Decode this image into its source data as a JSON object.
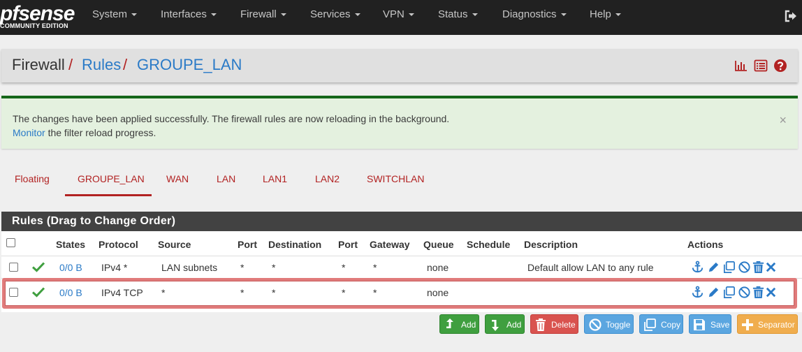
{
  "brand": {
    "name": "pfsense",
    "edition": "COMMUNITY EDITION"
  },
  "nav": {
    "items": [
      "System",
      "Interfaces",
      "Firewall",
      "Services",
      "VPN",
      "Status",
      "Diagnostics",
      "Help"
    ]
  },
  "breadcrumb": {
    "root": "Firewall",
    "sep": "/",
    "rules": "Rules",
    "current": "GROUPE_LAN"
  },
  "alert": {
    "line1": "The changes have been applied successfully. The firewall rules are now reloading in the background.",
    "link": "Monitor",
    "line2_rest": " the filter reload progress.",
    "close": "×"
  },
  "tabs": [
    "Floating",
    "GROUPE_LAN",
    "WAN",
    "LAN",
    "LAN1",
    "LAN2",
    "SWITCHLAN"
  ],
  "active_tab": "GROUPE_LAN",
  "rules_panel": {
    "title": "Rules (Drag to Change Order)",
    "columns": [
      "States",
      "Protocol",
      "Source",
      "Port",
      "Destination",
      "Port",
      "Gateway",
      "Queue",
      "Schedule",
      "Description",
      "Actions"
    ],
    "rows": [
      {
        "states": "0/0 B",
        "protocol": "IPv4 *",
        "source": "LAN subnets",
        "src_port": "*",
        "destination": "*",
        "dst_port": "*",
        "gateway": "*",
        "queue": "none",
        "schedule": "",
        "description": "Default allow LAN to any rule"
      },
      {
        "states": "0/0 B",
        "protocol": "IPv4 TCP",
        "source": "*",
        "src_port": "*",
        "destination": "*",
        "dst_port": "*",
        "gateway": "*",
        "queue": "none",
        "schedule": "",
        "description": ""
      }
    ]
  },
  "buttons": {
    "add_top": "Add",
    "add_bottom": "Add",
    "delete": "Delete",
    "toggle": "Toggle",
    "copy": "Copy",
    "save": "Save",
    "separator": "Separator"
  },
  "colors": {
    "navbar": "#212121",
    "accent_red": "#b22222",
    "link_blue": "#2a7ac7",
    "success_green": "#16661a",
    "alert_bg": "#e4f1df",
    "panel_head": "#424242",
    "btn_green": "#3f9f3f",
    "btn_red": "#d9534f",
    "btn_blue": "#5ba6e0",
    "btn_orange": "#f0ad4e"
  },
  "icons": {
    "header": [
      "chart-icon",
      "list-icon",
      "help-icon"
    ],
    "row_actions": [
      "anchor-icon",
      "pencil-icon",
      "copy-icon",
      "disable-icon",
      "trash-icon",
      "close-icon"
    ]
  }
}
